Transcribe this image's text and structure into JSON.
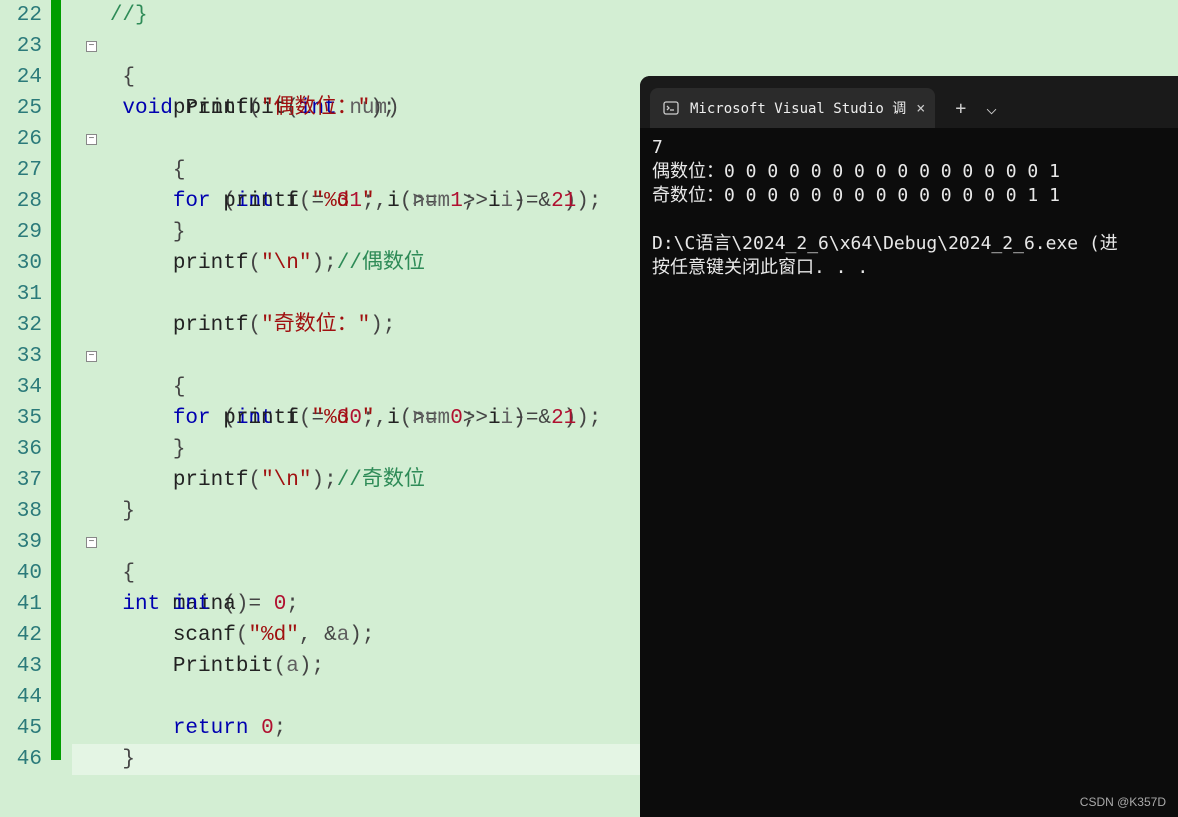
{
  "gutter": {
    "start": 22,
    "end": 46
  },
  "code": {
    "l22": {
      "comment": "//}"
    },
    "l23": {
      "kw1": "void",
      "fn": "Printbit",
      "kw2": "int",
      "param": "num"
    },
    "l24": {
      "brace": "{"
    },
    "l25": {
      "fn": "printf",
      "str": "\"偶数位：\""
    },
    "l26": {
      "kw1": "for",
      "kw2": "int",
      "var": "i",
      "init": "31",
      "cond_var": "i",
      "cond_op": ">=",
      "cond_val": "1",
      "step_var": "i",
      "step_op": "-=",
      "step_val": "2"
    },
    "l27": {
      "brace": "{"
    },
    "l28": {
      "fn": "printf",
      "str": "\"%d \"",
      "expr_a": "num",
      "expr_b": "i",
      "bit": "1"
    },
    "l29": {
      "brace": "}"
    },
    "l30": {
      "fn": "printf",
      "str": "\"\\n\"",
      "cm": "//偶数位"
    },
    "l32": {
      "fn": "printf",
      "str": "\"奇数位：\""
    },
    "l33": {
      "kw1": "for",
      "kw2": "int",
      "var": "i",
      "init": "30",
      "cond_var": "i",
      "cond_op": ">=",
      "cond_val": "0",
      "step_var": "i",
      "step_op": "-=",
      "step_val": "2"
    },
    "l34": {
      "brace": "{"
    },
    "l35": {
      "fn": "printf",
      "str": "\"%d \"",
      "expr_a": "num",
      "expr_b": "i",
      "bit": "1"
    },
    "l36": {
      "brace": "}"
    },
    "l37": {
      "fn": "printf",
      "str": "\"\\n\"",
      "cm": "//奇数位"
    },
    "l38": {
      "brace": "}"
    },
    "l39": {
      "kw1": "int",
      "fn": "main"
    },
    "l40": {
      "brace": "{"
    },
    "l41": {
      "kw": "int",
      "var": "a",
      "val": "0"
    },
    "l42": {
      "fn": "scanf",
      "str": "\"%d\"",
      "arg": "a"
    },
    "l43": {
      "fn": "Printbit",
      "arg": "a"
    },
    "l45": {
      "kw": "return",
      "val": "0"
    },
    "l46": {
      "brace": "}"
    }
  },
  "console": {
    "tab_title": "Microsoft Visual Studio 调",
    "out_line1": "7",
    "out_line2": "偶数位：0 0 0 0 0 0 0 0 0 0 0 0 0 0 0 1",
    "out_line3": "奇数位：0 0 0 0 0 0 0 0 0 0 0 0 0 0 1 1",
    "out_line4": "",
    "out_line5": "D:\\C语言\\2024_2_6\\x64\\Debug\\2024_2_6.exe (进",
    "out_line6": "按任意键关闭此窗口. . ."
  },
  "watermark": "CSDN @K357D",
  "icons": {
    "fold_minus": "−",
    "tab_close": "×",
    "new_tab": "+",
    "dropdown": "⌵"
  }
}
